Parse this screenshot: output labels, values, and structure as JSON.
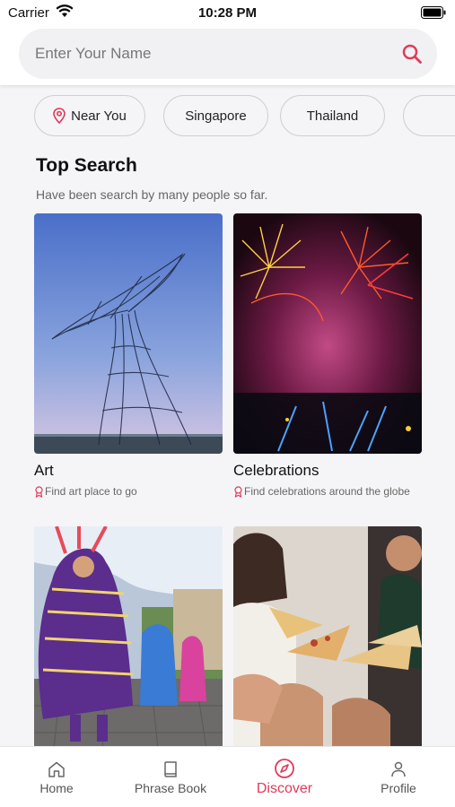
{
  "status_bar": {
    "carrier": "Carrier",
    "time": "10:28 PM"
  },
  "search": {
    "placeholder": "Enter Your Name",
    "value": ""
  },
  "filters": [
    {
      "label": "Near You",
      "icon": "location-pin-icon"
    },
    {
      "label": "Singapore"
    },
    {
      "label": "Thailand"
    },
    {
      "label": ""
    }
  ],
  "section": {
    "title": "Top Search",
    "subtitle": "Have been search by many people so far."
  },
  "cards": [
    {
      "title": "Art",
      "desc": "Find art place to go",
      "image": "wire whale-tail sculpture by the sea"
    },
    {
      "title": "Celebrations",
      "desc": "Find celebrations around the globe",
      "image": "fireworks over a crowd at night"
    },
    {
      "title": "",
      "desc": "",
      "image": "colorful traditional dancers in a town square"
    },
    {
      "title": "",
      "desc": "",
      "image": "friends sharing pizza slices"
    }
  ],
  "tabs": [
    {
      "label": "Home",
      "icon": "home-icon",
      "active": false
    },
    {
      "label": "Phrase Book",
      "icon": "book-icon",
      "active": false
    },
    {
      "label": "Discover",
      "icon": "compass-icon",
      "active": true
    },
    {
      "label": "Profile",
      "icon": "person-icon",
      "active": false
    }
  ],
  "colors": {
    "accent": "#e03a5b",
    "background": "#f5f5f7"
  }
}
